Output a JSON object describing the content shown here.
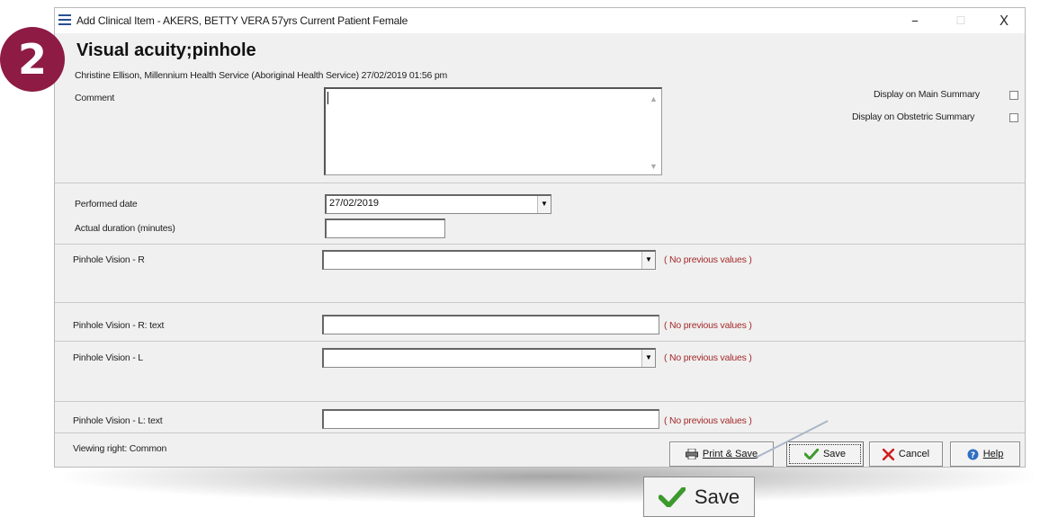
{
  "window": {
    "title": "Add Clinical Item - AKERS, BETTY VERA 57yrs Current Patient Female",
    "minimize": "–",
    "maximize": "☐",
    "close": "X"
  },
  "badge": {
    "number": "2",
    "color": "#8e1b44"
  },
  "header": {
    "item_title": "Visual acuity;pinhole",
    "author_line": "Christine Ellison, Millennium Health Service (Aboriginal Health Service) 27/02/2019 01:56 pm"
  },
  "comment": {
    "label": "Comment",
    "value": ""
  },
  "summary": {
    "main_label": "Display on Main Summary",
    "main_checked": false,
    "obstetric_label": "Display on Obstetric Summary",
    "obstetric_checked": false
  },
  "performed": {
    "date_label": "Performed date",
    "date_value": "27/02/2019",
    "duration_label": "Actual duration (minutes)",
    "duration_value": ""
  },
  "fields": [
    {
      "label": "Pinhole Vision - R",
      "value": "",
      "note": "( No previous values )"
    },
    {
      "label": "Pinhole Vision - R: text",
      "value": "",
      "note": "( No previous values )"
    },
    {
      "label": "Pinhole Vision - L",
      "value": "",
      "note": "( No previous values )"
    },
    {
      "label": "Pinhole Vision - L: text",
      "value": "",
      "note": "( No previous values )"
    }
  ],
  "footer": {
    "viewing_right": "Viewing right: Common",
    "print_save": "Print & Save",
    "save": "Save",
    "cancel": "Cancel",
    "help": "Help"
  },
  "callout": {
    "save_label": "Save"
  },
  "icons": {
    "app": "list-icon",
    "print": "printer-icon",
    "save": "checkmark-icon",
    "cancel": "x-icon",
    "help": "help-icon"
  }
}
